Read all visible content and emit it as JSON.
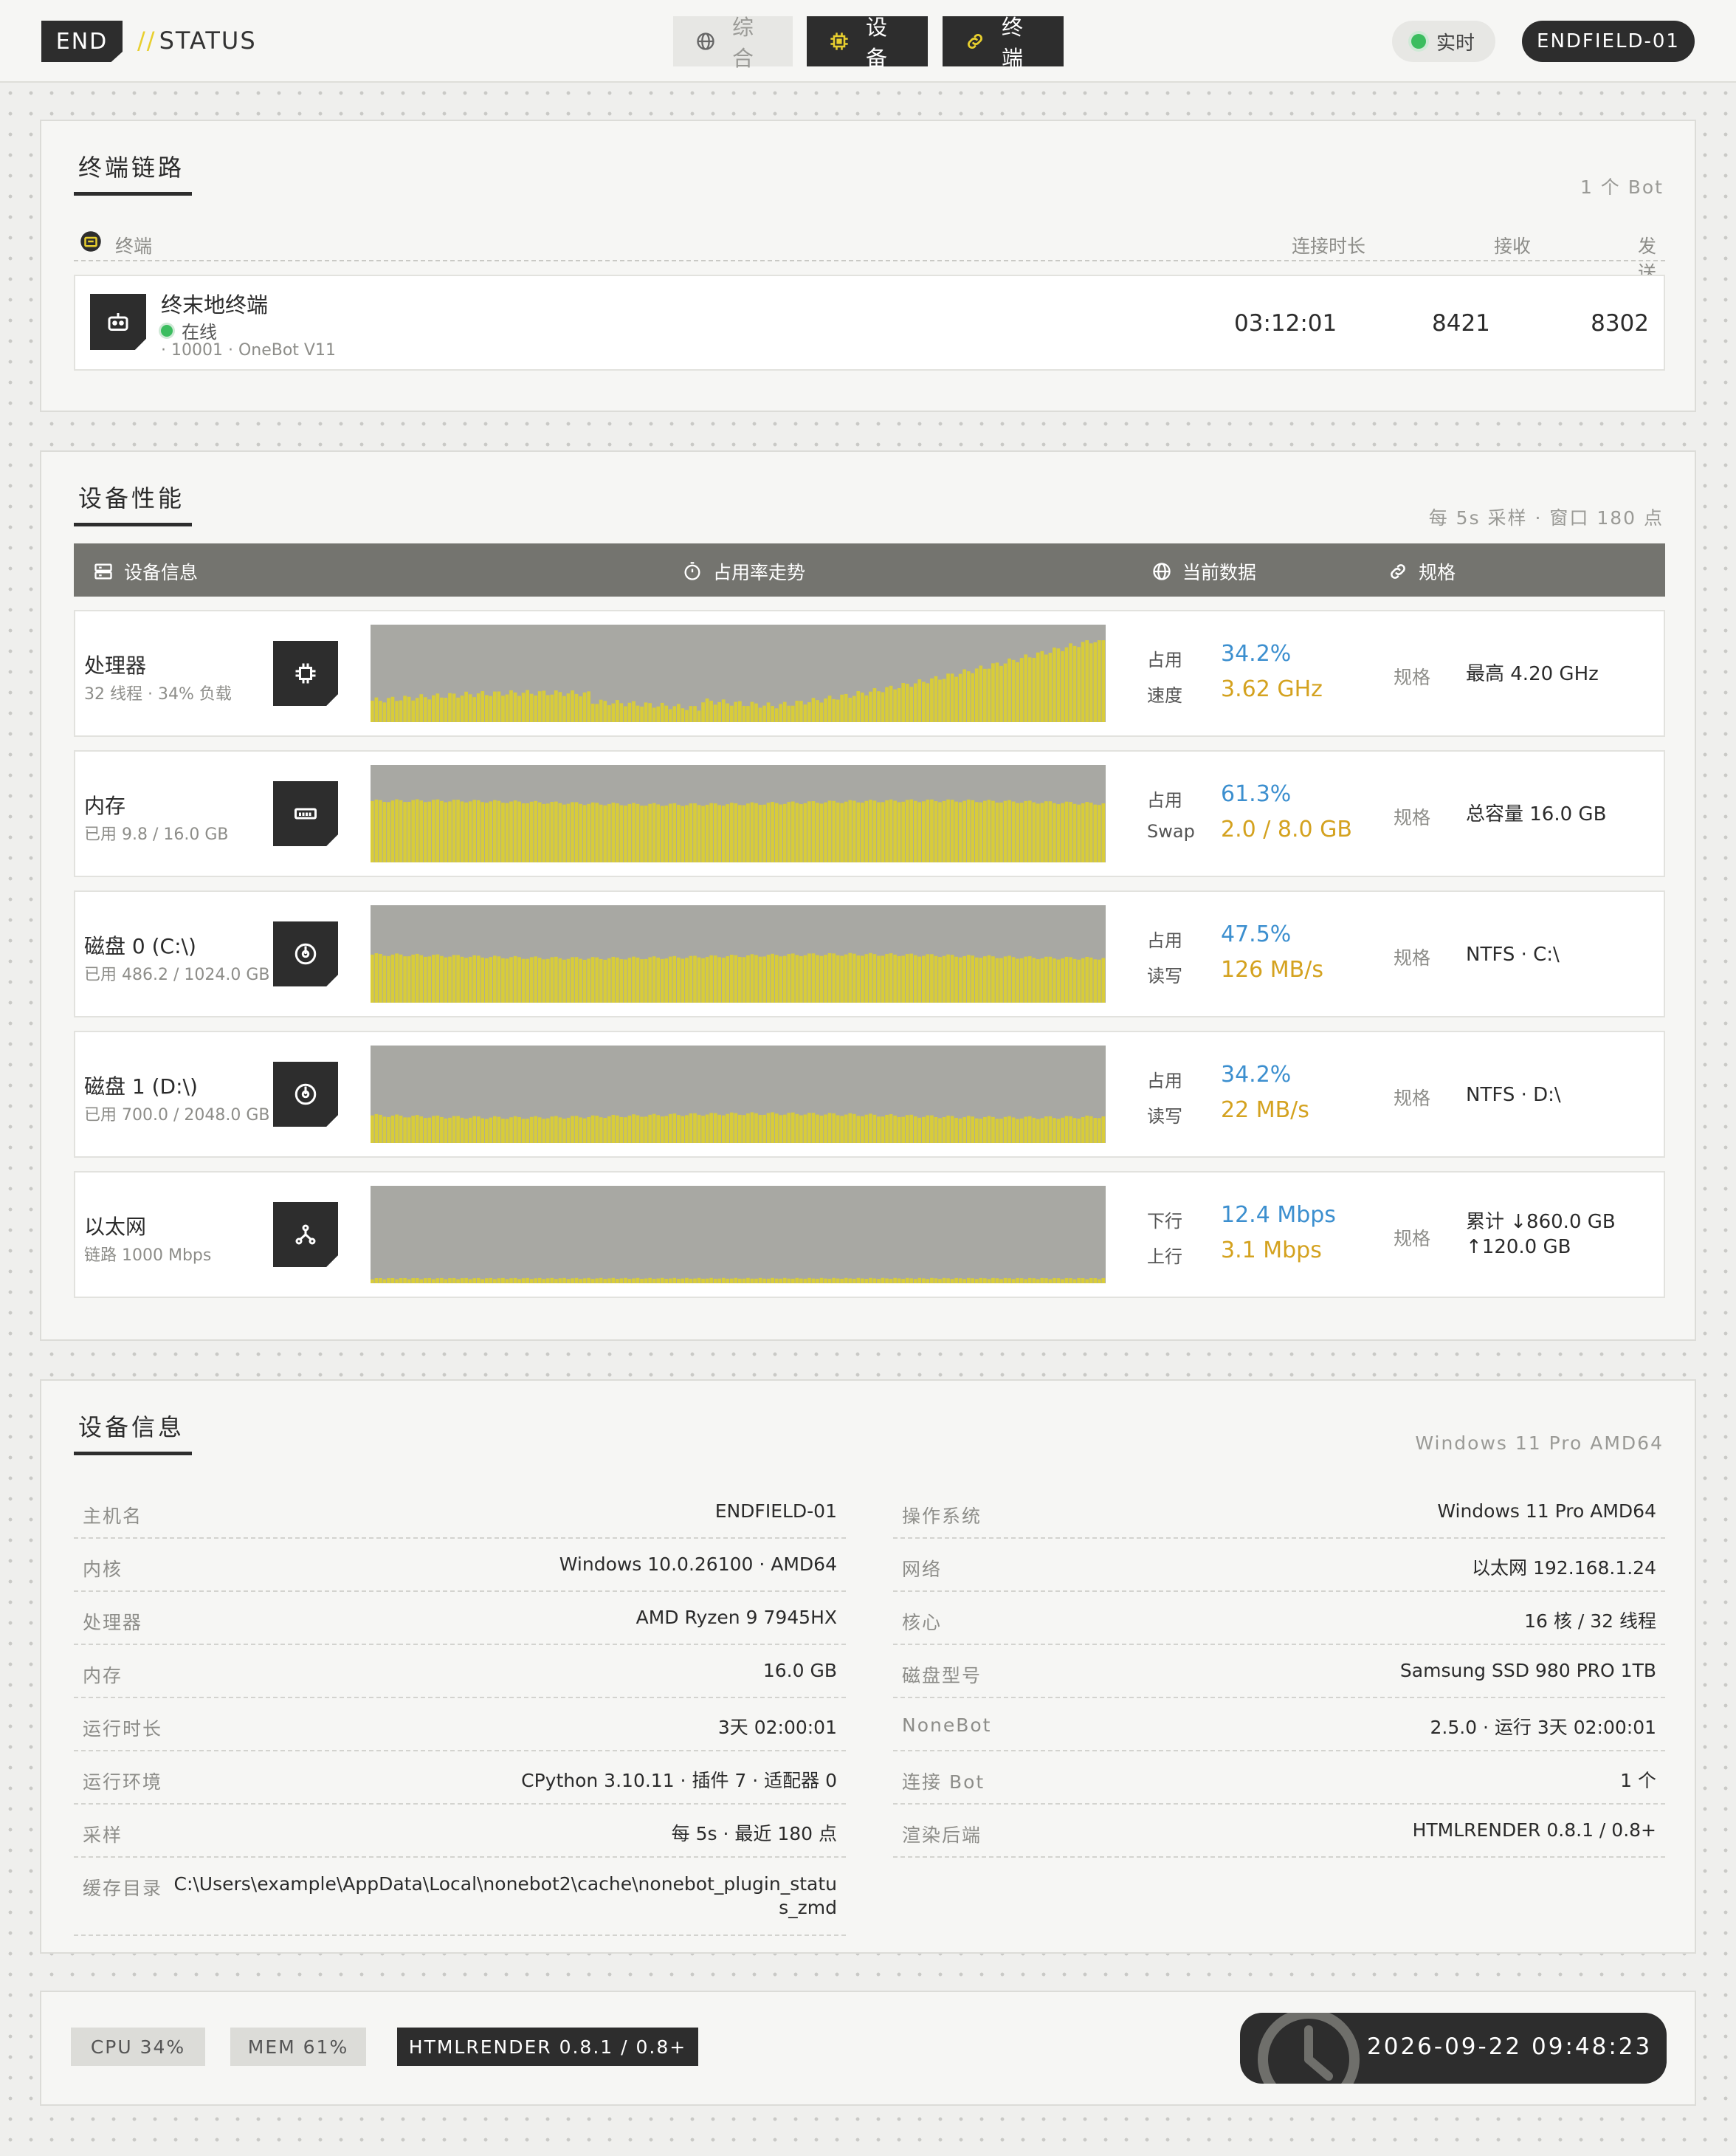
{
  "header": {
    "brand_box": "END",
    "brand_slashes": "//",
    "brand_text": "STATUS",
    "tabs": [
      {
        "label": "综合",
        "icon": "globe-icon",
        "active": false
      },
      {
        "label": "设备",
        "icon": "chip-icon",
        "active": true
      },
      {
        "label": "终端",
        "icon": "link-icon",
        "active": true
      }
    ],
    "live_label": "实时",
    "host": "ENDFIELD-01"
  },
  "terminals": {
    "title": "终端链路",
    "meta": "1 个 Bot",
    "columns": {
      "terminal": "终端",
      "uptime": "连接时长",
      "recv": "接收",
      "send": "发送"
    },
    "rows": [
      {
        "name": "终末地终端",
        "status": "在线",
        "sub": "· 10001 · OneBot V11",
        "uptime": "03:12:01",
        "recv": "8421",
        "send": "8302"
      }
    ]
  },
  "performance": {
    "title": "设备性能",
    "meta": "每 5s 采样 · 窗口 180 点",
    "columns": {
      "info": "设备信息",
      "trend": "占用率走势",
      "current": "当前数据",
      "spec": "规格"
    },
    "rows": [
      {
        "name": "处理器",
        "sub": "32 线程 · 34% 负载",
        "icon": "cpu-icon",
        "k1": "占用",
        "v1": "34.2%",
        "k2": "速度",
        "v2": "3.62 GHz",
        "spec_label": "规格",
        "spec": "最高 4.20 GHz",
        "spec2": ""
      },
      {
        "name": "内存",
        "sub": "已用 9.8 / 16.0 GB",
        "icon": "memory-icon",
        "k1": "占用",
        "v1": "61.3%",
        "k2": "Swap",
        "v2": "2.0 / 8.0 GB",
        "spec_label": "规格",
        "spec": "总容量 16.0 GB",
        "spec2": ""
      },
      {
        "name": "磁盘 0 (C:\\)",
        "sub": "已用 486.2 / 1024.0 GB",
        "icon": "disk-icon",
        "k1": "占用",
        "v1": "47.5%",
        "k2": "读写",
        "v2": "126 MB/s",
        "spec_label": "规格",
        "spec": "NTFS · C:\\",
        "spec2": ""
      },
      {
        "name": "磁盘 1 (D:\\)",
        "sub": "已用 700.0 / 2048.0 GB",
        "icon": "disk-icon",
        "k1": "占用",
        "v1": "34.2%",
        "k2": "读写",
        "v2": "22 MB/s",
        "spec_label": "规格",
        "spec": "NTFS · D:\\",
        "spec2": ""
      },
      {
        "name": "以太网",
        "sub": "链路 1000 Mbps",
        "icon": "network-icon",
        "k1": "下行",
        "v1": "12.4 Mbps",
        "k2": "上行",
        "v2": "3.1 Mbps",
        "spec_label": "规格",
        "spec": "累计 ↓860.0 GB",
        "spec2": "↑120.0 GB"
      }
    ],
    "trend_levels": [
      0.34,
      0.613,
      0.475,
      0.28,
      0.03
    ],
    "colors": {
      "bar": "#d8cc3a",
      "bg": "#a8a8a3"
    }
  },
  "device_info": {
    "title": "设备信息",
    "meta": "Windows 11 Pro AMD64",
    "left": [
      {
        "k": "主机名",
        "v": "ENDFIELD-01"
      },
      {
        "k": "内核",
        "v": "Windows 10.0.26100 · AMD64"
      },
      {
        "k": "处理器",
        "v": "AMD Ryzen 9 7945HX"
      },
      {
        "k": "内存",
        "v": "16.0 GB"
      },
      {
        "k": "运行时长",
        "v": "3天 02:00:01"
      },
      {
        "k": "运行环境",
        "v": "CPython 3.10.11 · 插件 7 · 适配器 0"
      },
      {
        "k": "采样",
        "v": "每 5s · 最近 180 点"
      },
      {
        "k": "缓存目录",
        "v": "C:\\Users\\example\\AppData\\Local\\nonebot2\\cache\\nonebot_plugin_status_zmd"
      }
    ],
    "right": [
      {
        "k": "操作系统",
        "v": "Windows 11 Pro AMD64"
      },
      {
        "k": "网络",
        "v": "以太网 192.168.1.24"
      },
      {
        "k": "核心",
        "v": "16 核 / 32 线程"
      },
      {
        "k": "磁盘型号",
        "v": "Samsung SSD 980 PRO 1TB"
      },
      {
        "k": "NoneBot",
        "v": "2.5.0 · 运行 3天 02:00:01"
      },
      {
        "k": "连接 Bot",
        "v": "1 个"
      },
      {
        "k": "渲染后端",
        "v": "HTMLRENDER 0.8.1 / 0.8+"
      }
    ]
  },
  "footer": {
    "cpu": "CPU 34%",
    "mem": "MEM 61%",
    "render": "HTMLRENDER 0.8.1 / 0.8+",
    "datetime": "2026-09-22 09:48:23"
  }
}
